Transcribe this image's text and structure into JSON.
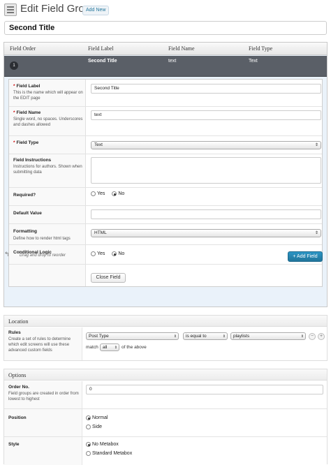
{
  "header": {
    "title": "Edit Field Group",
    "add_new": "Add New"
  },
  "group_title": "Second Title",
  "fields_table": {
    "columns": [
      "Field Order",
      "Field Label",
      "Field Name",
      "Field Type"
    ],
    "row": {
      "order": "1",
      "label": "Second Title",
      "name": "text",
      "type": "Text"
    }
  },
  "field_settings": {
    "label": {
      "title": "Field Label",
      "desc": "This is the name which will appear on the EDIT page",
      "value": "Second Title"
    },
    "name": {
      "title": "Field Name",
      "desc": "Single word, no spaces. Underscores and dashes allowed",
      "value": "text"
    },
    "type": {
      "title": "Field Type",
      "value": "Text"
    },
    "instructions": {
      "title": "Field Instructions",
      "desc": "Instructions for authors. Shown when submitting data",
      "value": ""
    },
    "required": {
      "title": "Required?",
      "options": [
        "Yes",
        "No"
      ],
      "selected": "No"
    },
    "default_value": {
      "title": "Default Value",
      "value": ""
    },
    "formatting": {
      "title": "Formatting",
      "desc": "Define how to render html tags",
      "value": "HTML"
    },
    "conditional": {
      "title": "Conditional Logic",
      "options": [
        "Yes",
        "No"
      ],
      "selected": "No"
    },
    "close_button": "Close Field"
  },
  "footer": {
    "drag_hint": "Drag and drop to reorder",
    "add_field": "+ Add Field"
  },
  "location": {
    "heading": "Location",
    "rules_title": "Rules",
    "rules_desc": "Create a set of rules to determine which edit screens will use these advanced custom fields",
    "param": "Post Type",
    "operator": "is equal to",
    "value": "playlists",
    "match_label": "match",
    "match_value": "all",
    "match_suffix": "of the above",
    "remove": "−",
    "add": "+"
  },
  "options": {
    "heading": "Options",
    "order_title": "Order No.",
    "order_desc": "Field groups are created in order from lowest to highest",
    "order_value": "0",
    "position_title": "Position",
    "position_options": [
      "Normal",
      "Side"
    ],
    "position_selected": "Normal",
    "style_title": "Style",
    "style_options": [
      "No Metabox",
      "Standard Metabox"
    ],
    "style_selected": "No Metabox"
  },
  "colors": {
    "accent": "#21759b",
    "row_selected": "#5a5f67",
    "required": "#cc0000"
  }
}
